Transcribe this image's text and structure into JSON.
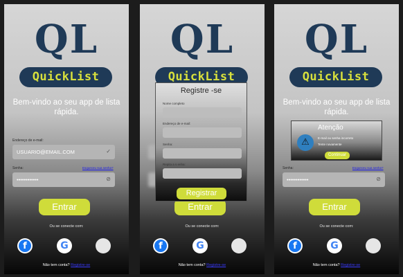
{
  "app": {
    "logo_mark": "QL",
    "logo_name": "QuickList",
    "welcome": "Bem-vindo ao seu app de lista rápida."
  },
  "login": {
    "email_label": "Endereço de e-mail:",
    "email_value": "USUARIO@EMAIL.COM",
    "password_label": "Senha:",
    "password_value": "••••••••••••",
    "forgot_link": "Esqueceu sua senha?",
    "enter_button": "Entrar",
    "connect_text": "Ou se conecte com:",
    "no_account": "Não tem conta?",
    "register_link": "Registre-se"
  },
  "social": {
    "facebook": "f",
    "google": "G",
    "apple": ""
  },
  "register_modal": {
    "title": "Registre -se",
    "name_label": "Nome completo",
    "email_label": "Endereço de e-mail:",
    "password_label": "Senha:",
    "repeat_label": "Repita a s enha:",
    "submit": "Registrar"
  },
  "alert_modal": {
    "title": "Atenção",
    "icon": "⚠",
    "line1": "E-mail ou senha incorreto",
    "line2": "Tente novamente",
    "continue": "Continuar"
  },
  "colors": {
    "brand_navy": "#1f3a57",
    "brand_yellow": "#d8e03c",
    "button": "#cfdc3a",
    "link": "#1a1aee"
  }
}
